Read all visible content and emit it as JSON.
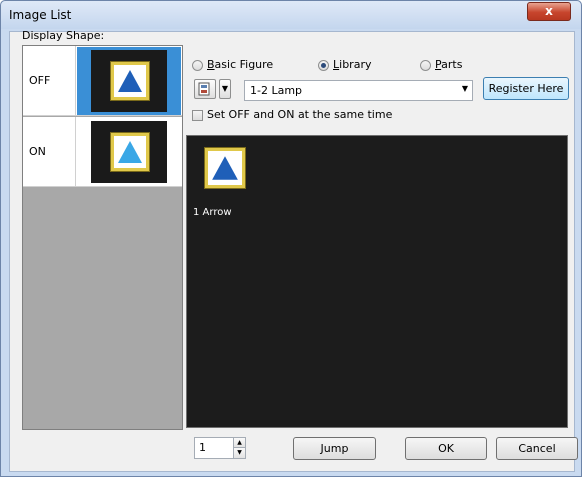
{
  "window": {
    "title": "Image List",
    "close_glyph": "x"
  },
  "display_shape": {
    "label": "Display Shape:",
    "rows": [
      {
        "state": "OFF",
        "selected": true,
        "triangle_color": "#1f5fb8"
      },
      {
        "state": "ON",
        "selected": false,
        "triangle_color": "#3aa7e6"
      }
    ]
  },
  "source": {
    "options": [
      {
        "label": "Basic Figure",
        "mnemonic": "B",
        "checked": false
      },
      {
        "label": "Library",
        "mnemonic": "L",
        "checked": true
      },
      {
        "label": "Parts",
        "mnemonic": "P",
        "checked": false
      }
    ]
  },
  "library_select": {
    "value": "1-2 Lamp",
    "icon": "library-icon"
  },
  "register_button": "Register Here",
  "set_same_time": {
    "label": "Set OFF and ON at the same time",
    "checked": false
  },
  "library_items": [
    {
      "label": "1 Arrow",
      "mnemonic": "A",
      "icon": "arrow-lamp-icon"
    }
  ],
  "page_spinner": {
    "value": "1"
  },
  "jump_button": "Jump",
  "ok_button": "OK",
  "cancel_button": "Cancel",
  "colors": {
    "accent_selected": "#3a8fd6",
    "library_background": "#1c1c1c",
    "lamp_border": "#e0c84a"
  }
}
